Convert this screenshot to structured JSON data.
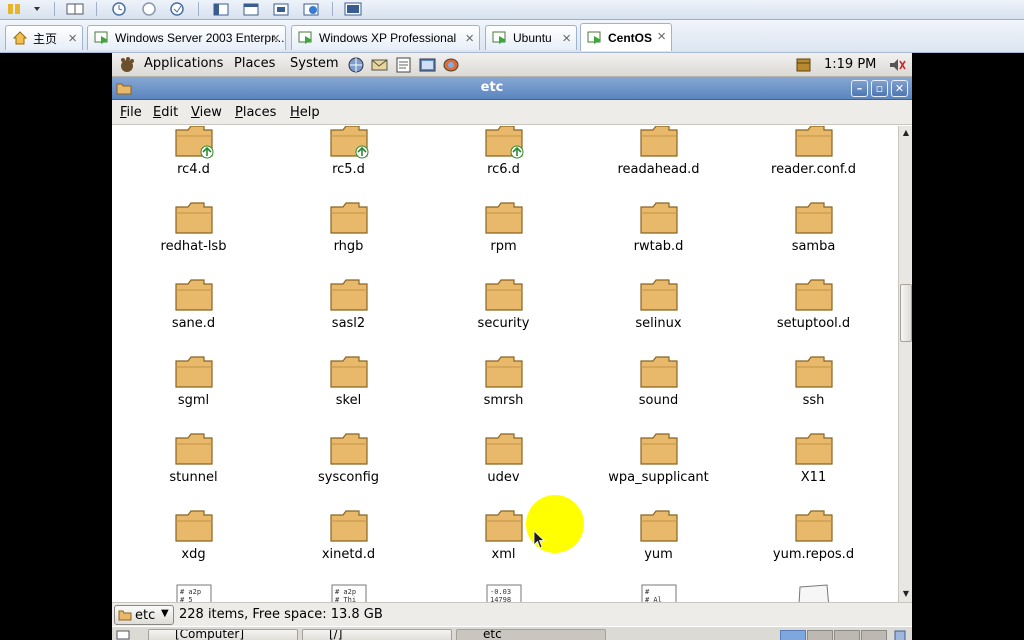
{
  "host_tabs": [
    {
      "label": "主页",
      "icon": "home-icon",
      "active": false
    },
    {
      "label": "Windows Server 2003 Enterpr...",
      "icon": "vm-running-icon",
      "active": false
    },
    {
      "label": "Windows XP Professional",
      "icon": "vm-running-icon",
      "active": false
    },
    {
      "label": "Ubuntu",
      "icon": "vm-running-icon",
      "active": false
    },
    {
      "label": "CentOS",
      "icon": "vm-running-icon",
      "active": true
    }
  ],
  "panel": {
    "menus": [
      "Applications",
      "Places",
      "System"
    ],
    "clock": "1:19 PM"
  },
  "window": {
    "title": "etc",
    "menus": [
      {
        "accel": "F",
        "rest": "ile"
      },
      {
        "accel": "E",
        "rest": "dit"
      },
      {
        "accel": "V",
        "rest": "iew"
      },
      {
        "accel": "P",
        "rest": "laces"
      },
      {
        "accel": "H",
        "rest": "elp"
      }
    ]
  },
  "files": [
    {
      "name": "rc4.d",
      "type": "folder-link"
    },
    {
      "name": "rc5.d",
      "type": "folder-link"
    },
    {
      "name": "rc6.d",
      "type": "folder-link"
    },
    {
      "name": "readahead.d",
      "type": "folder"
    },
    {
      "name": "reader.conf.d",
      "type": "folder"
    },
    {
      "name": "redhat-lsb",
      "type": "folder"
    },
    {
      "name": "rhgb",
      "type": "folder"
    },
    {
      "name": "rpm",
      "type": "folder"
    },
    {
      "name": "rwtab.d",
      "type": "folder"
    },
    {
      "name": "samba",
      "type": "folder"
    },
    {
      "name": "sane.d",
      "type": "folder"
    },
    {
      "name": "sasl2",
      "type": "folder"
    },
    {
      "name": "security",
      "type": "folder"
    },
    {
      "name": "selinux",
      "type": "folder"
    },
    {
      "name": "setuptool.d",
      "type": "folder"
    },
    {
      "name": "sgml",
      "type": "folder"
    },
    {
      "name": "skel",
      "type": "folder"
    },
    {
      "name": "smrsh",
      "type": "folder"
    },
    {
      "name": "sound",
      "type": "folder"
    },
    {
      "name": "ssh",
      "type": "folder"
    },
    {
      "name": "stunnel",
      "type": "folder"
    },
    {
      "name": "sysconfig",
      "type": "folder"
    },
    {
      "name": "udev",
      "type": "folder"
    },
    {
      "name": "wpa_supplicant",
      "type": "folder"
    },
    {
      "name": "X11",
      "type": "folder"
    },
    {
      "name": "xdg",
      "type": "folder"
    },
    {
      "name": "xinetd.d",
      "type": "folder"
    },
    {
      "name": "xml",
      "type": "folder"
    },
    {
      "name": "yum",
      "type": "folder"
    },
    {
      "name": "yum.repos.d",
      "type": "folder"
    },
    {
      "name": "",
      "type": "text-file",
      "preview": [
        "# a2p",
        "# 5"
      ]
    },
    {
      "name": "",
      "type": "text-file",
      "preview": [
        "# a2p",
        "# Thi"
      ]
    },
    {
      "name": "",
      "type": "text-file",
      "preview": [
        "-0.03",
        "14798"
      ]
    },
    {
      "name": "",
      "type": "text-file",
      "preview": [
        "#",
        "# Al"
      ]
    },
    {
      "name": "",
      "type": "blank-file"
    }
  ],
  "statusbar": {
    "location": "etc",
    "summary": "228 items, Free space: 13.8 GB"
  },
  "taskbar": [
    {
      "label": "[Computer]"
    },
    {
      "label": "[/]"
    },
    {
      "label": "etc"
    }
  ],
  "colors": {
    "folder_fill": "#e8b96a",
    "titlebar": "#6e93c8",
    "cursor_highlight": "#ffff00"
  }
}
